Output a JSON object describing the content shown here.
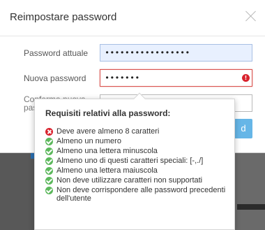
{
  "dialog": {
    "title": "Reimpostare password",
    "fields": {
      "current_label": "Password attuale",
      "current_value": "•••••••••••••••••",
      "new_label": "Nuova password",
      "new_value": "•••••••",
      "confirm_label": "Conferma nuova password"
    },
    "primary_button_label": "d"
  },
  "popover": {
    "title": "Requisiti relativi alla password:",
    "requirements": [
      {
        "text": "Deve avere almeno 8 caratteri",
        "status": "fail"
      },
      {
        "text": "Almeno un numero",
        "status": "ok"
      },
      {
        "text": "Almeno una lettera minuscola",
        "status": "ok"
      },
      {
        "text": "Almeno uno di questi caratteri speciali: [-,./]",
        "status": "ok"
      },
      {
        "text": "Almeno una lettera maiuscola",
        "status": "ok"
      },
      {
        "text": "Non deve utilizzare caratteri non supportati",
        "status": "ok"
      },
      {
        "text": "Non deve corrispondere alle password precedenti dell'utente",
        "status": "ok"
      }
    ]
  },
  "colors": {
    "fail": "#d9232e",
    "ok": "#5cb85c",
    "accent": "#66b6e7"
  }
}
